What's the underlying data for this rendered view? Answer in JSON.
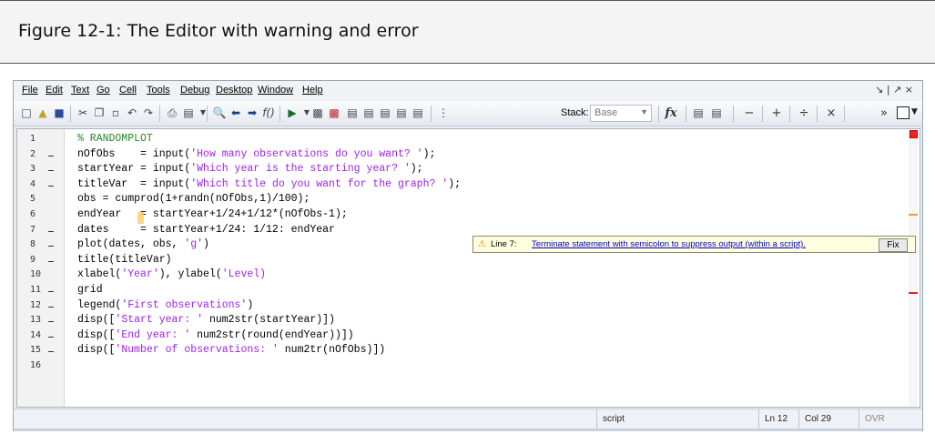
{
  "figure": {
    "caption": "Figure 12-1: The Editor with warning and error"
  },
  "menubar": {
    "items": [
      "File",
      "Edit",
      "Text",
      "Go",
      "Cell",
      "Tools",
      "Debug",
      "Desktop",
      "Window",
      "Help"
    ],
    "window_controls": "↘ | ↗ ×"
  },
  "toolbar": {
    "stack_label": "Stack:",
    "stack_value": "Base",
    "fx_label": "fx",
    "cell_ops": [
      "−",
      "+",
      "÷",
      "×"
    ],
    "chevron": "»"
  },
  "editor": {
    "lines": [
      {
        "num": "1",
        "dash": false,
        "segments": [
          {
            "t": "% RANDOMPLOT",
            "k": "cmt"
          }
        ]
      },
      {
        "num": "2",
        "dash": true,
        "segments": [
          {
            "t": "nOfObs    = input(",
            "k": "code"
          },
          {
            "t": "'How many observations do you want? '",
            "k": "str"
          },
          {
            "t": ");",
            "k": "code"
          }
        ]
      },
      {
        "num": "3",
        "dash": true,
        "segments": [
          {
            "t": "startYear = input(",
            "k": "code"
          },
          {
            "t": "'Which year is the starting year? '",
            "k": "str"
          },
          {
            "t": ");",
            "k": "code"
          }
        ]
      },
      {
        "num": "4",
        "dash": true,
        "segments": [
          {
            "t": "titleVar  = input(",
            "k": "code"
          },
          {
            "t": "'Which title do you want for the graph? '",
            "k": "str"
          },
          {
            "t": ");",
            "k": "code"
          }
        ]
      },
      {
        "num": "5",
        "dash": false,
        "segments": [
          {
            "t": "obs = cumprod(1+randn(nOfObs,1)/100);",
            "k": "code"
          }
        ]
      },
      {
        "num": "6",
        "dash": false,
        "segments": [
          {
            "t": "endYear   = startYear+1/24+1/12*(nOfObs-1);",
            "k": "code"
          }
        ]
      },
      {
        "num": "7",
        "dash": true,
        "segments": [
          {
            "t": "dates     = startYear+1/24: 1/12: endYear",
            "k": "code"
          }
        ]
      },
      {
        "num": "8",
        "dash": true,
        "segments": [
          {
            "t": "plot(dates, obs, ",
            "k": "code"
          },
          {
            "t": "'g'",
            "k": "str"
          },
          {
            "t": ")",
            "k": "code"
          }
        ]
      },
      {
        "num": "9",
        "dash": true,
        "segments": [
          {
            "t": "title(titleVar)",
            "k": "code"
          }
        ]
      },
      {
        "num": "10",
        "dash": false,
        "segments": [
          {
            "t": "xlabel(",
            "k": "code"
          },
          {
            "t": "'Year'",
            "k": "str"
          },
          {
            "t": "), ylabel(",
            "k": "code"
          },
          {
            "t": "'Level)",
            "k": "str"
          }
        ]
      },
      {
        "num": "11",
        "dash": true,
        "segments": [
          {
            "t": "grid",
            "k": "code"
          }
        ]
      },
      {
        "num": "12",
        "dash": true,
        "segments": [
          {
            "t": "legend(",
            "k": "code"
          },
          {
            "t": "'First observations'",
            "k": "str"
          },
          {
            "t": ")",
            "k": "code"
          }
        ]
      },
      {
        "num": "13",
        "dash": true,
        "segments": [
          {
            "t": "disp([",
            "k": "code"
          },
          {
            "t": "'Start year: '",
            "k": "str"
          },
          {
            "t": " num2str(startYear)])",
            "k": "code"
          }
        ]
      },
      {
        "num": "14",
        "dash": true,
        "segments": [
          {
            "t": "disp([",
            "k": "code"
          },
          {
            "t": "'End year: '",
            "k": "str"
          },
          {
            "t": " num2str(round(endYear))])",
            "k": "code"
          }
        ]
      },
      {
        "num": "15",
        "dash": true,
        "segments": [
          {
            "t": "disp([",
            "k": "code"
          },
          {
            "t": "'Number of observations: '",
            "k": "str"
          },
          {
            "t": " num2tr(nOfObs)])",
            "k": "code"
          }
        ]
      },
      {
        "num": "16",
        "dash": false,
        "segments": []
      }
    ]
  },
  "tooltip": {
    "prefix": "Line 7:",
    "message": "Terminate statement with semicolon to suppress output (within a script).",
    "fix_label": "Fix"
  },
  "statusbar": {
    "mode": "script",
    "ln": "Ln  12",
    "col": "Col  29",
    "ovr": "OVR"
  },
  "colors": {
    "string": "#a020f0",
    "comment": "#228b22",
    "error": "#e12525",
    "warning": "#f0a020"
  }
}
